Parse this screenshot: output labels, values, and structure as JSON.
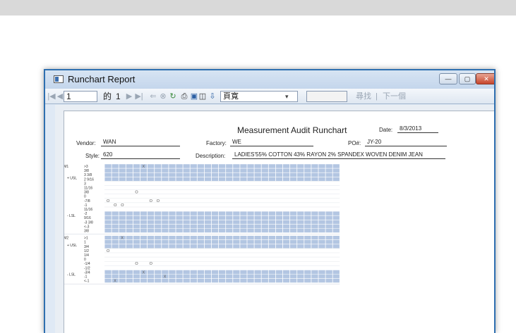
{
  "window": {
    "title": "Runchart Report"
  },
  "toolbar": {
    "page_current": "1",
    "page_of": "的",
    "page_total": "1",
    "zoom_value": "頁寬",
    "find_label": "尋找",
    "separator": "|",
    "next_label": "下一個"
  },
  "report": {
    "title": "Measurement Audit Runchart",
    "date_label": "Date:",
    "date_value": "8/3/2013",
    "vendor_label": "Vendor:",
    "vendor_value": "WAN",
    "factory_label": "Factory:",
    "factory_value": "WE",
    "po_label": "PO#:",
    "po_value": "JY-20",
    "style_label": "Style:",
    "style_value": "620",
    "description_label": "Description:",
    "description_value": "LADIES'55% COTTON 43% RAYON 2% SPANDEX WOVEN DENIM JEAN"
  },
  "chart_data": {
    "type": "table",
    "points": [
      {
        "name": "POM1",
        "usl_label": "+ USL",
        "lsl_label": "- LSL",
        "rows": [
          {
            "label": ">3",
            "shaded": true,
            "marks": [
              {
                "col": 5,
                "sym": "X"
              }
            ]
          },
          {
            "label": "3/8",
            "shaded": true,
            "marks": []
          },
          {
            "label": "3 3/8",
            "shaded": true,
            "marks": []
          },
          {
            "label": "2 9/16",
            "shaded": true,
            "marks": []
          },
          {
            "label": "3",
            "shaded": false,
            "marks": []
          },
          {
            "label": "11/16",
            "shaded": false,
            "marks": []
          },
          {
            "label": "3/8",
            "shaded": false,
            "marks": [
              {
                "col": 4,
                "sym": "O"
              }
            ]
          },
          {
            "label": "0",
            "shaded": false,
            "marks": []
          },
          {
            "label": "-7/8",
            "shaded": false,
            "marks": [
              {
                "col": 0,
                "sym": "O"
              },
              {
                "col": 6,
                "sym": "O"
              },
              {
                "col": 7,
                "sym": "O"
              }
            ]
          },
          {
            "label": "-1",
            "shaded": false,
            "marks": [
              {
                "col": 1,
                "sym": "O"
              },
              {
                "col": 2,
                "sym": "O"
              }
            ]
          },
          {
            "label": "11/16",
            "shaded": false,
            "marks": []
          },
          {
            "label": "-2",
            "shaded": true,
            "marks": []
          },
          {
            "label": "9/16",
            "shaded": true,
            "marks": []
          },
          {
            "label": "-3 3/8",
            "shaded": true,
            "marks": []
          },
          {
            "label": "<-3",
            "shaded": true,
            "marks": []
          },
          {
            "label": "3/8",
            "shaded": true,
            "marks": []
          }
        ]
      },
      {
        "name": "POM2",
        "usl_label": "+ USL",
        "lsl_label": "- LSL",
        "rows": [
          {
            "label": ">1",
            "shaded": true,
            "marks": [
              {
                "col": 2,
                "sym": "X"
              }
            ]
          },
          {
            "label": "1",
            "shaded": true,
            "marks": []
          },
          {
            "label": "3/4",
            "shaded": true,
            "marks": []
          },
          {
            "label": "1/2",
            "shaded": false,
            "marks": [
              {
                "col": 0,
                "sym": "O"
              }
            ]
          },
          {
            "label": "1/4",
            "shaded": false,
            "marks": []
          },
          {
            "label": "0",
            "shaded": false,
            "marks": []
          },
          {
            "label": "-1/4",
            "shaded": false,
            "marks": [
              {
                "col": 4,
                "sym": "O"
              },
              {
                "col": 6,
                "sym": "O"
              }
            ]
          },
          {
            "label": "-1/2",
            "shaded": false,
            "marks": []
          },
          {
            "label": "-3/4",
            "shaded": true,
            "marks": [
              {
                "col": 5,
                "sym": "X"
              }
            ]
          },
          {
            "label": "-1",
            "shaded": true,
            "marks": [
              {
                "col": 8,
                "sym": "X"
              }
            ]
          },
          {
            "label": "<-1",
            "shaded": true,
            "marks": [
              {
                "col": 1,
                "sym": "X"
              }
            ]
          }
        ]
      }
    ],
    "columns": 33
  },
  "colors": {
    "shade": "#b3c6e2",
    "grid": "#ffffff",
    "window_border": "#2e6fb0"
  }
}
